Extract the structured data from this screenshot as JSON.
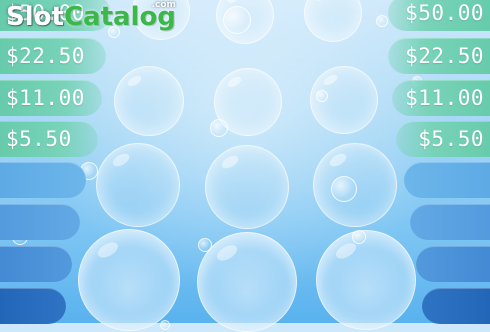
{
  "logo": {
    "part1": "Slot",
    "part2": "Catalog",
    "suffix": ".com"
  },
  "left_prizes": [
    "$50.00",
    "$22.50",
    "$11.00",
    "$5.50"
  ],
  "right_prizes": [
    "$50.00",
    "$22.50",
    "$11.00",
    "$5.50"
  ],
  "colors": {
    "prize_active": "#61c9a6",
    "level_light": "#5aa7e4",
    "level_dark": "#1f62b4",
    "background": "#7fc6f3"
  }
}
